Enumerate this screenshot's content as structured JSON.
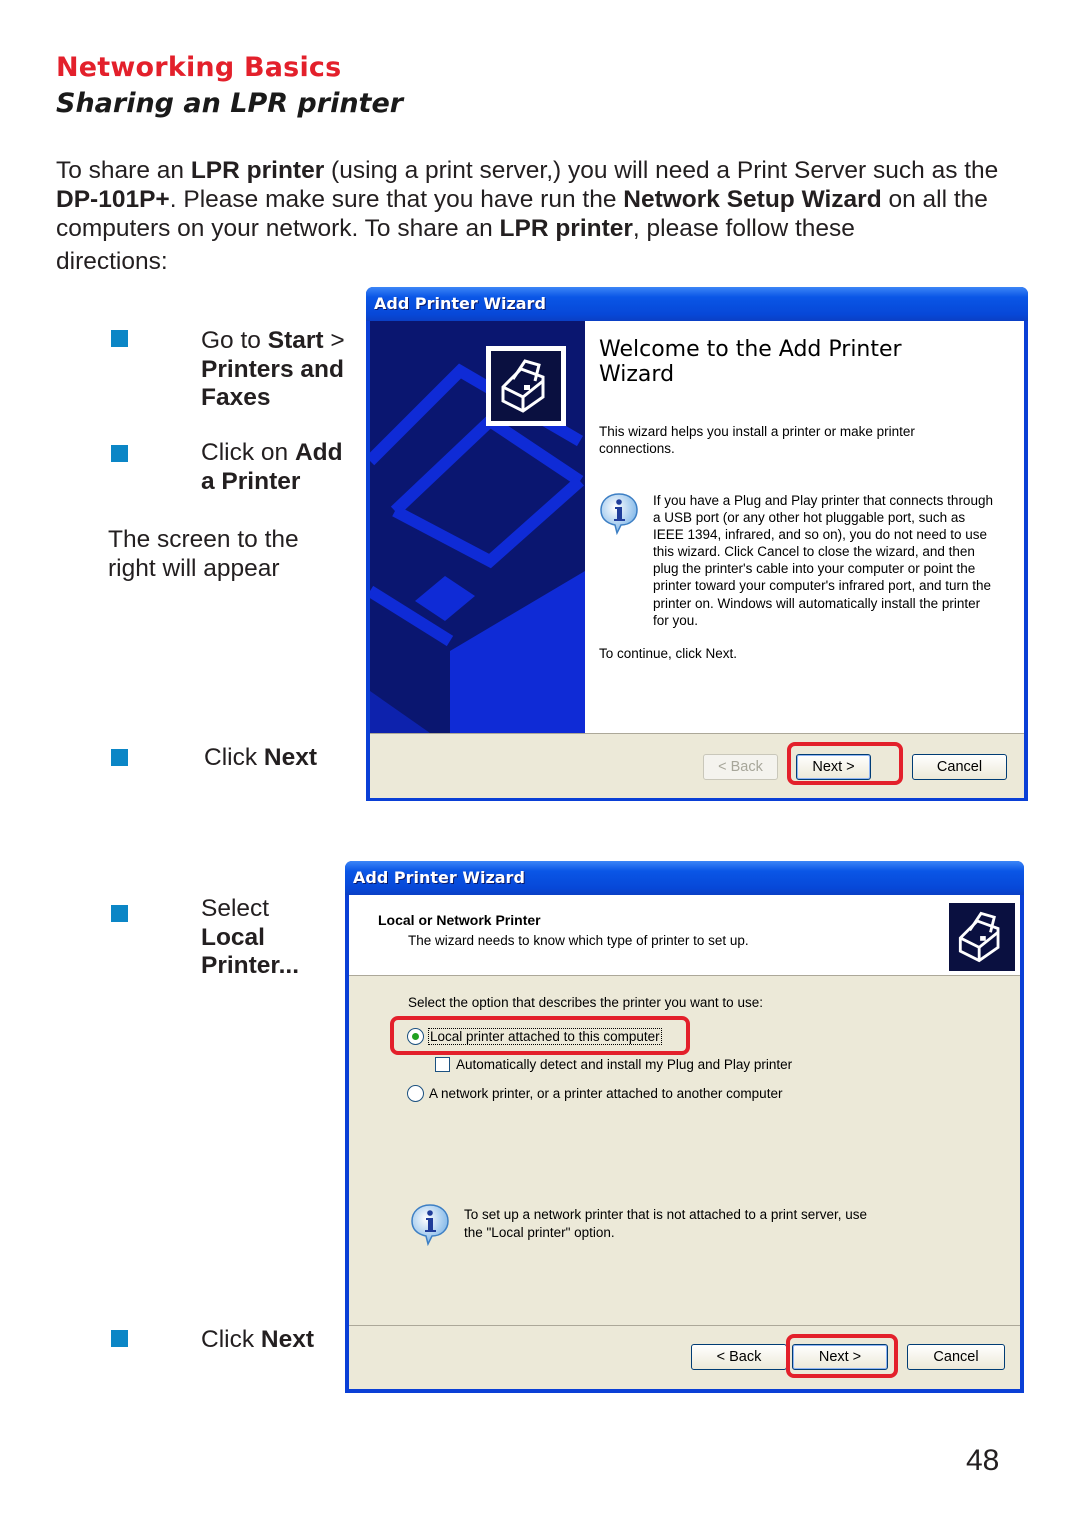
{
  "page": {
    "section_title": "Networking Basics",
    "subtitle": "Sharing an LPR printer",
    "page_number": "48"
  },
  "intro": {
    "p1": "To share an ",
    "b1": "LPR printer",
    "p2": " (using a print server,) you will need a Print Server such as the ",
    "b2": "DP-101P+",
    "p3": ".  Please make sure that you have run the ",
    "b3": "Network Setup Wizard",
    "p4": " on all the computers on your network. To share an ",
    "b4": "LPR printer",
    "p5": ", please follow these",
    "p6": "directions:"
  },
  "steps": {
    "step1": {
      "text": "Go to ",
      "bold1": "Start",
      "text2": " >",
      "bold2": "Printers and Faxes"
    },
    "step2": {
      "text": "Click on ",
      "bold1": "Add",
      "bold2": "a Printer"
    },
    "note": "The screen to the right will appear",
    "step3": {
      "text": "Click ",
      "bold": "Next"
    },
    "step4": {
      "text": "Select",
      "bold1": "Local",
      "bold2": "Printer..."
    },
    "step5": {
      "text": "Click ",
      "bold": "Next"
    }
  },
  "wizard1": {
    "title": "Add Printer Wizard",
    "heading": "Welcome to the Add Printer Wizard",
    "description": "This wizard helps you install a printer or make printer connections.",
    "info_text": "If you have a Plug and Play printer that connects through a USB port (or any other hot pluggable port, such as IEEE 1394, infrared, and so on), you do not need to use this wizard. Click Cancel to close the wizard, and then plug the printer's cable into your computer or point the printer toward your computer's infrared port, and turn the printer on. Windows will automatically install the printer for you.",
    "continue_text": "To continue, click Next.",
    "buttons": {
      "back": "< Back",
      "next": "Next >",
      "cancel": "Cancel"
    },
    "highlighted_button": "next"
  },
  "wizard2": {
    "title": "Add Printer Wizard",
    "header_title": "Local or Network Printer",
    "header_subtitle": "The wizard needs to know which type of printer to set up.",
    "prompt": "Select the option that describes the printer you want to use:",
    "options": [
      {
        "label": "Local printer attached to this computer",
        "type": "radio",
        "selected": true
      },
      {
        "label": "Automatically detect and install my Plug and Play printer",
        "type": "checkbox",
        "checked": false
      },
      {
        "label": "A network printer, or a printer attached to another computer",
        "type": "radio",
        "selected": false
      }
    ],
    "info_text": "To set up a network printer that is not attached to a print server, use the \"Local printer\" option.",
    "buttons": {
      "back": "< Back",
      "next": "Next >",
      "cancel": "Cancel"
    },
    "highlighted_button": "next"
  },
  "colors": {
    "accent_red": "#e3202b",
    "bullet_blue": "#0b86c6",
    "xp_title_blue": "#0a56e6",
    "xp_panel_navy": "#0a1670"
  }
}
